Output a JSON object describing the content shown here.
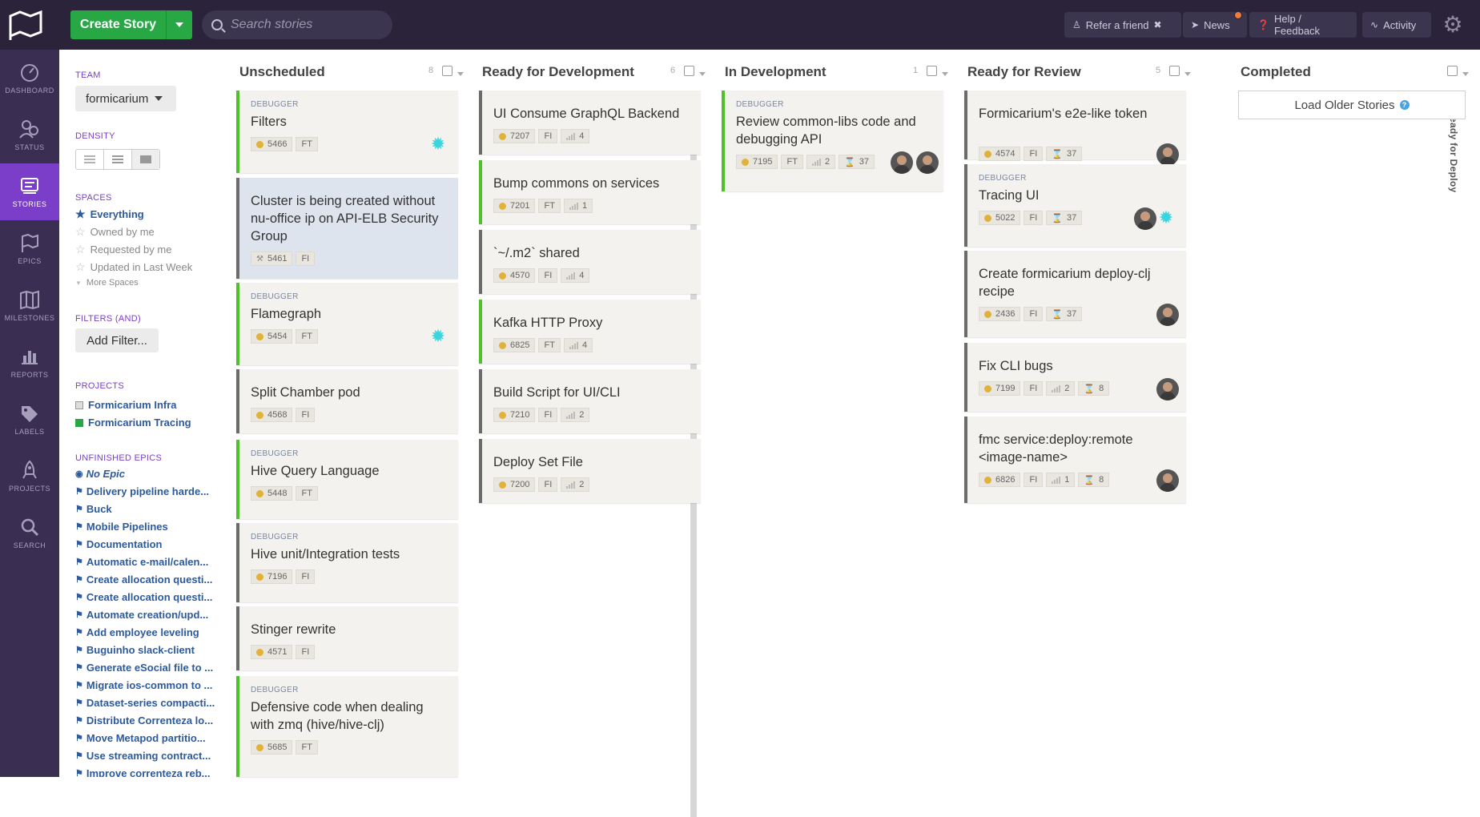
{
  "topbar": {
    "create_label": "Create Story",
    "search_placeholder": "Search stories",
    "refer_label": "Refer a friend",
    "news_label": "News",
    "help_label": "Help / Feedback",
    "activity_label": "Activity"
  },
  "nav": [
    {
      "label": "DASHBOARD",
      "icon": "dashboard-icon"
    },
    {
      "label": "STATUS",
      "icon": "status-icon"
    },
    {
      "label": "STORIES",
      "icon": "stories-icon",
      "active": true
    },
    {
      "label": "EPICS",
      "icon": "epics-icon"
    },
    {
      "label": "MILESTONES",
      "icon": "milestones-icon"
    },
    {
      "label": "REPORTS",
      "icon": "reports-icon"
    },
    {
      "label": "LABELS",
      "icon": "labels-icon"
    },
    {
      "label": "PROJECTS",
      "icon": "projects-icon"
    },
    {
      "label": "SEARCH",
      "icon": "search-icon"
    }
  ],
  "sidebar": {
    "team_heading": "TEAM",
    "team_value": "formicarium",
    "density_heading": "DENSITY",
    "spaces_heading": "SPACES",
    "spaces": [
      "Everything",
      "Owned by me",
      "Requested by me",
      "Updated in Last Week",
      "More Spaces"
    ],
    "filters_heading": "FILTERS (AND)",
    "add_filter_label": "Add Filter...",
    "projects_heading": "PROJECTS",
    "projects": [
      "Formicarium Infra",
      "Formicarium Tracing"
    ],
    "epics_heading": "UNFINISHED EPICS",
    "epics": [
      "No Epic",
      "Delivery pipeline harde...",
      "Buck",
      "Mobile Pipelines",
      "Documentation",
      "Automatic e-mail/calen...",
      "Create allocation questi...",
      "Create allocation questi...",
      "Automate creation/upd...",
      "Add employee leveling",
      "Buguinho slack-client",
      "Generate eSocial file to ...",
      "Migrate ios-common to ...",
      "Dataset-series compacti...",
      "Distribute Correnteza lo...",
      "Move Metapod partitio...",
      "Use streaming contract...",
      "Improve correnteza reb..."
    ]
  },
  "columns": [
    {
      "title": "Unscheduled",
      "count": "8"
    },
    {
      "title": "Ready for Development",
      "count": "6"
    },
    {
      "title": "In Development",
      "count": "1"
    },
    {
      "title": "Ready for Review",
      "count": "5"
    },
    {
      "title": "Completed",
      "count": ""
    }
  ],
  "ready_for_deploy_label": "Ready for Deploy",
  "load_older_label": "Load Older Stories",
  "kind_label": "DEBUGGER",
  "cards": {
    "unscheduled": [
      {
        "kind": "DEBUGGER",
        "title": "Filters",
        "id": "5466",
        "proj": "FT"
      },
      {
        "title": "Cluster is being created without nu-office ip on API-ELB Security Group",
        "id": "5461",
        "proj": "FI"
      },
      {
        "kind": "DEBUGGER",
        "title": "Flamegraph",
        "id": "5454",
        "proj": "FT"
      },
      {
        "title": "Split Chamber pod",
        "id": "4568",
        "proj": "FI"
      },
      {
        "kind": "DEBUGGER",
        "title": "Hive Query Language",
        "id": "5448",
        "proj": "FT"
      },
      {
        "kind": "DEBUGGER",
        "title": "Hive unit/Integration tests",
        "id": "7196",
        "proj": "FI"
      },
      {
        "title": "Stinger rewrite",
        "id": "4571",
        "proj": "FI"
      },
      {
        "kind": "DEBUGGER",
        "title": "Defensive code when dealing with zmq (hive/hive-clj)",
        "id": "5685",
        "proj": "FT"
      }
    ],
    "ready_dev": [
      {
        "title": "UI Consume GraphQL Backend",
        "id": "7207",
        "proj": "FI",
        "est": "4"
      },
      {
        "title": "Bump commons on services",
        "id": "7201",
        "proj": "FT",
        "est": "1"
      },
      {
        "title": "`~/.m2` shared",
        "id": "4570",
        "proj": "FI",
        "est": "4"
      },
      {
        "title": "Kafka HTTP Proxy",
        "id": "6825",
        "proj": "FT",
        "est": "4"
      },
      {
        "title": "Build Script for UI/CLI",
        "id": "7210",
        "proj": "FI",
        "est": "2"
      },
      {
        "title": "Deploy Set File",
        "id": "7200",
        "proj": "FI",
        "est": "2"
      }
    ],
    "in_dev": [
      {
        "kind": "DEBUGGER",
        "title": "Review common-libs code and debugging API",
        "id": "7195",
        "proj": "FT",
        "est": "2",
        "age": "37"
      }
    ],
    "ready_review": [
      {
        "title": "Formicarium's e2e-like token",
        "id": "4574",
        "proj": "FI",
        "age": "37"
      },
      {
        "kind": "DEBUGGER",
        "title": "Tracing UI",
        "id": "5022",
        "proj": "FI",
        "age": "37"
      },
      {
        "title": "Create formicarium deploy-clj recipe",
        "id": "2436",
        "proj": "FI",
        "age": "37"
      },
      {
        "title": "Fix CLI bugs",
        "id": "7199",
        "proj": "FI",
        "est": "2",
        "age": "8"
      },
      {
        "title": "fmc service:deploy:remote <image-name>",
        "id": "6826",
        "proj": "FI",
        "est": "1",
        "age": "8"
      }
    ]
  }
}
